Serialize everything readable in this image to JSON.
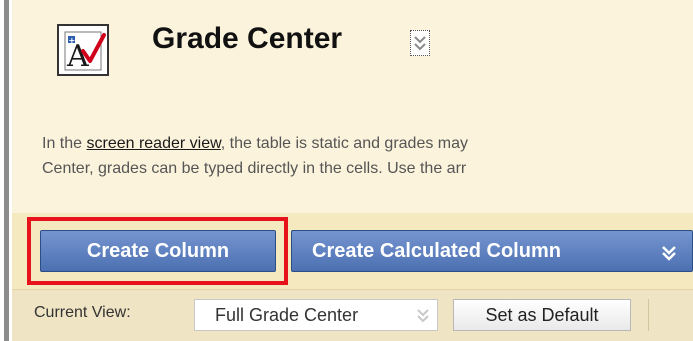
{
  "page": {
    "title": "Grade Center",
    "icon": "grade-book-icon"
  },
  "info": {
    "line1_before": "In the ",
    "link": "screen reader view",
    "line1_after": ", the table is static and grades may",
    "line2": "Center, grades can be typed directly in the cells. Use the arr"
  },
  "actions": {
    "create_column": "Create Column",
    "create_calculated_column": "Create Calculated Column"
  },
  "view": {
    "label": "Current View:",
    "selected": "Full Grade Center",
    "set_default": "Set as Default"
  },
  "colors": {
    "highlight": "#e6131b",
    "button": "#5a7bbd",
    "panel": "#fbf3dc"
  }
}
